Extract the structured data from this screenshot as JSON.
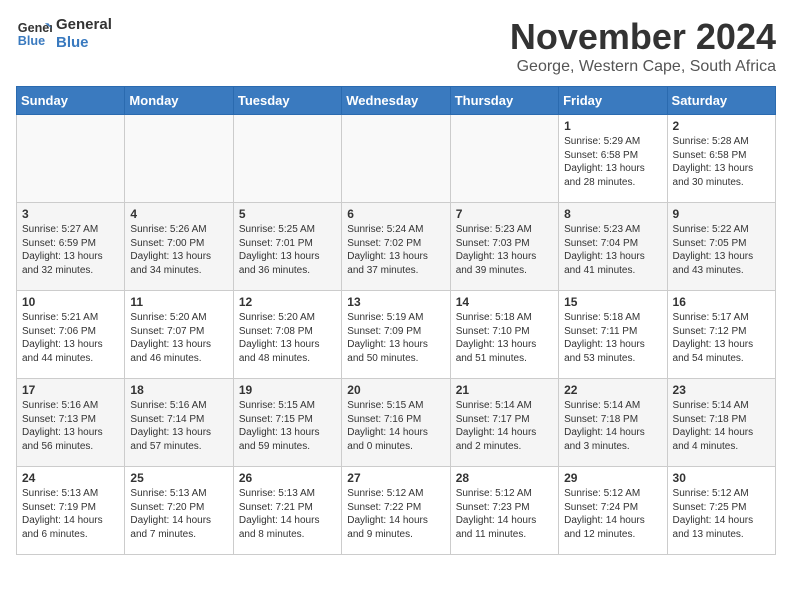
{
  "header": {
    "logo_line1": "General",
    "logo_line2": "Blue",
    "title": "November 2024",
    "subtitle": "George, Western Cape, South Africa"
  },
  "weekdays": [
    "Sunday",
    "Monday",
    "Tuesday",
    "Wednesday",
    "Thursday",
    "Friday",
    "Saturday"
  ],
  "weeks": [
    [
      {
        "day": "",
        "content": ""
      },
      {
        "day": "",
        "content": ""
      },
      {
        "day": "",
        "content": ""
      },
      {
        "day": "",
        "content": ""
      },
      {
        "day": "",
        "content": ""
      },
      {
        "day": "1",
        "content": "Sunrise: 5:29 AM\nSunset: 6:58 PM\nDaylight: 13 hours\nand 28 minutes."
      },
      {
        "day": "2",
        "content": "Sunrise: 5:28 AM\nSunset: 6:58 PM\nDaylight: 13 hours\nand 30 minutes."
      }
    ],
    [
      {
        "day": "3",
        "content": "Sunrise: 5:27 AM\nSunset: 6:59 PM\nDaylight: 13 hours\nand 32 minutes."
      },
      {
        "day": "4",
        "content": "Sunrise: 5:26 AM\nSunset: 7:00 PM\nDaylight: 13 hours\nand 34 minutes."
      },
      {
        "day": "5",
        "content": "Sunrise: 5:25 AM\nSunset: 7:01 PM\nDaylight: 13 hours\nand 36 minutes."
      },
      {
        "day": "6",
        "content": "Sunrise: 5:24 AM\nSunset: 7:02 PM\nDaylight: 13 hours\nand 37 minutes."
      },
      {
        "day": "7",
        "content": "Sunrise: 5:23 AM\nSunset: 7:03 PM\nDaylight: 13 hours\nand 39 minutes."
      },
      {
        "day": "8",
        "content": "Sunrise: 5:23 AM\nSunset: 7:04 PM\nDaylight: 13 hours\nand 41 minutes."
      },
      {
        "day": "9",
        "content": "Sunrise: 5:22 AM\nSunset: 7:05 PM\nDaylight: 13 hours\nand 43 minutes."
      }
    ],
    [
      {
        "day": "10",
        "content": "Sunrise: 5:21 AM\nSunset: 7:06 PM\nDaylight: 13 hours\nand 44 minutes."
      },
      {
        "day": "11",
        "content": "Sunrise: 5:20 AM\nSunset: 7:07 PM\nDaylight: 13 hours\nand 46 minutes."
      },
      {
        "day": "12",
        "content": "Sunrise: 5:20 AM\nSunset: 7:08 PM\nDaylight: 13 hours\nand 48 minutes."
      },
      {
        "day": "13",
        "content": "Sunrise: 5:19 AM\nSunset: 7:09 PM\nDaylight: 13 hours\nand 50 minutes."
      },
      {
        "day": "14",
        "content": "Sunrise: 5:18 AM\nSunset: 7:10 PM\nDaylight: 13 hours\nand 51 minutes."
      },
      {
        "day": "15",
        "content": "Sunrise: 5:18 AM\nSunset: 7:11 PM\nDaylight: 13 hours\nand 53 minutes."
      },
      {
        "day": "16",
        "content": "Sunrise: 5:17 AM\nSunset: 7:12 PM\nDaylight: 13 hours\nand 54 minutes."
      }
    ],
    [
      {
        "day": "17",
        "content": "Sunrise: 5:16 AM\nSunset: 7:13 PM\nDaylight: 13 hours\nand 56 minutes."
      },
      {
        "day": "18",
        "content": "Sunrise: 5:16 AM\nSunset: 7:14 PM\nDaylight: 13 hours\nand 57 minutes."
      },
      {
        "day": "19",
        "content": "Sunrise: 5:15 AM\nSunset: 7:15 PM\nDaylight: 13 hours\nand 59 minutes."
      },
      {
        "day": "20",
        "content": "Sunrise: 5:15 AM\nSunset: 7:16 PM\nDaylight: 14 hours\nand 0 minutes."
      },
      {
        "day": "21",
        "content": "Sunrise: 5:14 AM\nSunset: 7:17 PM\nDaylight: 14 hours\nand 2 minutes."
      },
      {
        "day": "22",
        "content": "Sunrise: 5:14 AM\nSunset: 7:18 PM\nDaylight: 14 hours\nand 3 minutes."
      },
      {
        "day": "23",
        "content": "Sunrise: 5:14 AM\nSunset: 7:18 PM\nDaylight: 14 hours\nand 4 minutes."
      }
    ],
    [
      {
        "day": "24",
        "content": "Sunrise: 5:13 AM\nSunset: 7:19 PM\nDaylight: 14 hours\nand 6 minutes."
      },
      {
        "day": "25",
        "content": "Sunrise: 5:13 AM\nSunset: 7:20 PM\nDaylight: 14 hours\nand 7 minutes."
      },
      {
        "day": "26",
        "content": "Sunrise: 5:13 AM\nSunset: 7:21 PM\nDaylight: 14 hours\nand 8 minutes."
      },
      {
        "day": "27",
        "content": "Sunrise: 5:12 AM\nSunset: 7:22 PM\nDaylight: 14 hours\nand 9 minutes."
      },
      {
        "day": "28",
        "content": "Sunrise: 5:12 AM\nSunset: 7:23 PM\nDaylight: 14 hours\nand 11 minutes."
      },
      {
        "day": "29",
        "content": "Sunrise: 5:12 AM\nSunset: 7:24 PM\nDaylight: 14 hours\nand 12 minutes."
      },
      {
        "day": "30",
        "content": "Sunrise: 5:12 AM\nSunset: 7:25 PM\nDaylight: 14 hours\nand 13 minutes."
      }
    ]
  ]
}
